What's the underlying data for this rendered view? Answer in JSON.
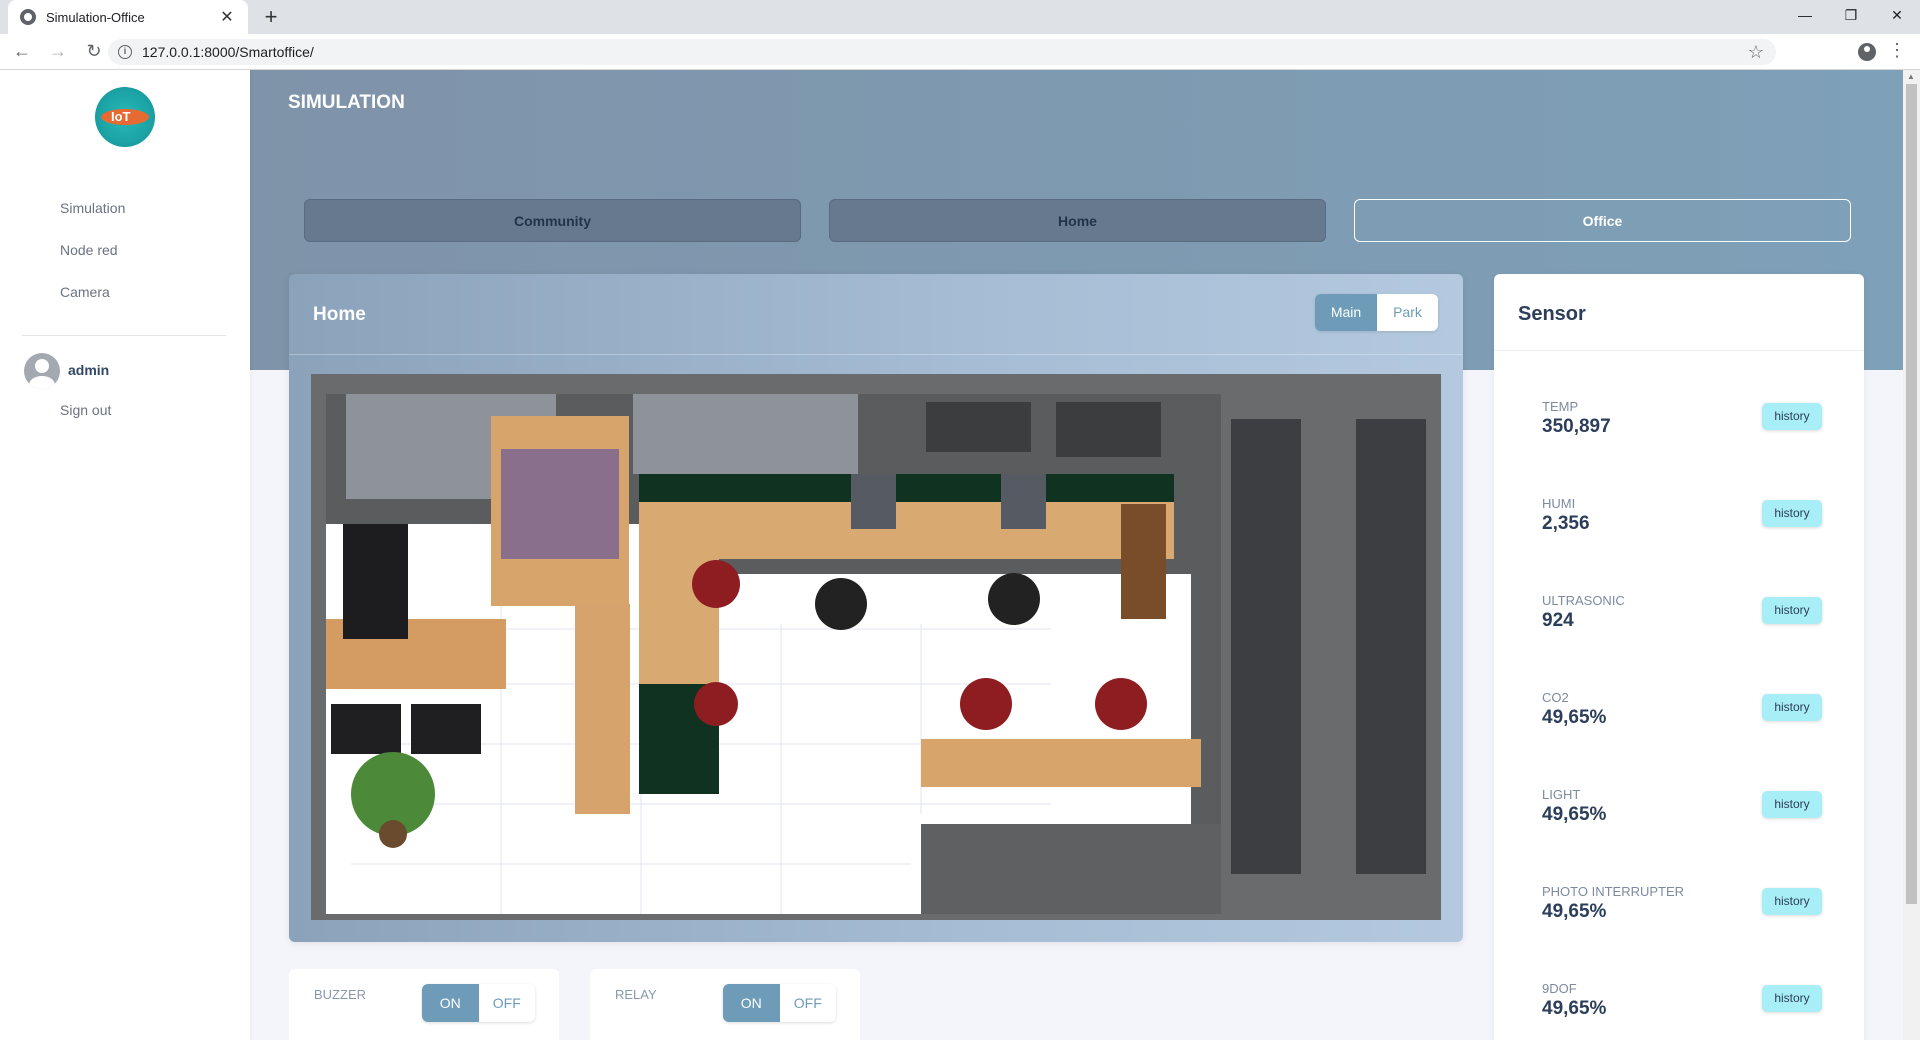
{
  "browser": {
    "tab_title": "Simulation-Office",
    "url": "127.0.0.1:8000/Smartoffice/"
  },
  "sidebar": {
    "items": [
      {
        "label": "Simulation"
      },
      {
        "label": "Node red"
      },
      {
        "label": "Camera"
      }
    ],
    "user": "admin",
    "signout": "Sign out"
  },
  "page": {
    "title": "SIMULATION",
    "nav": [
      "Community",
      "Home",
      "Office"
    ],
    "active_nav": "Office"
  },
  "main_card": {
    "title": "Home",
    "views": [
      "Main",
      "Park"
    ],
    "active_view": "Main"
  },
  "controls": [
    {
      "label": "BUZZER",
      "on": "ON",
      "off": "OFF",
      "state": "ON"
    },
    {
      "label": "RELAY",
      "on": "ON",
      "off": "OFF",
      "state": "ON"
    }
  ],
  "sensor": {
    "title": "Sensor",
    "history_label": "history",
    "items": [
      {
        "name": "TEMP",
        "value": "350,897"
      },
      {
        "name": "HUMI",
        "value": "2,356"
      },
      {
        "name": "ULTRASONIC",
        "value": "924"
      },
      {
        "name": "CO2",
        "value": "49,65%"
      },
      {
        "name": "LIGHT",
        "value": "49,65%"
      },
      {
        "name": "PHOTO INTERRUPTER",
        "value": "49,65%"
      },
      {
        "name": "9DOF",
        "value": "49,65%"
      }
    ]
  },
  "colors": {
    "banner": "#7e98b0",
    "accent": "#6d9bb8",
    "history_btn": "#a8eef6",
    "text_dark": "#2c3e5a"
  },
  "icons": [
    "globe-icon",
    "close-icon",
    "plus-icon",
    "back-icon",
    "forward-icon",
    "reload-icon",
    "info-icon",
    "star-icon",
    "account-icon",
    "menu-icon",
    "logo",
    "user-avatar-icon"
  ]
}
